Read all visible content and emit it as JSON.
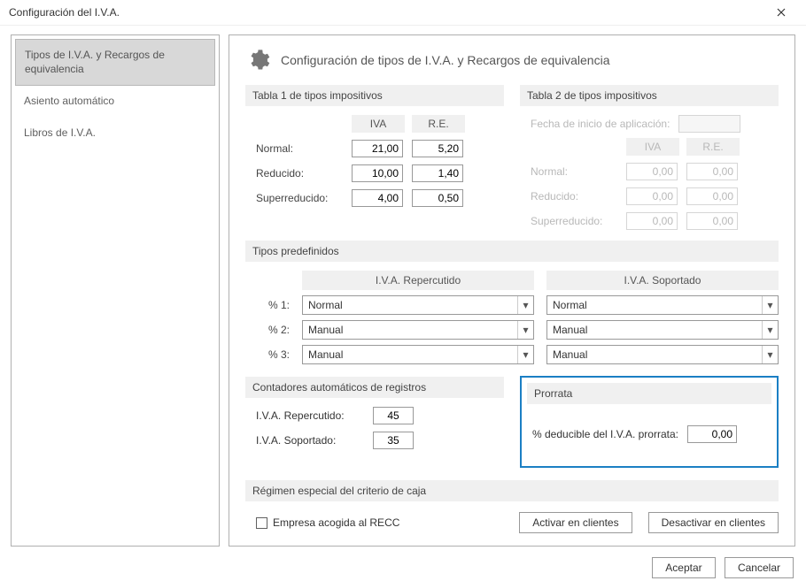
{
  "window": {
    "title": "Configuración del I.V.A."
  },
  "sidebar": {
    "items": [
      {
        "label": "Tipos de I.V.A. y Recargos de equivalencia",
        "active": true
      },
      {
        "label": "Asiento automático",
        "active": false
      },
      {
        "label": "Libros de I.V.A.",
        "active": false
      }
    ]
  },
  "page": {
    "title": "Configuración de tipos de I.V.A. y Recargos de equivalencia"
  },
  "tabla1": {
    "header": "Tabla 1 de tipos impositivos",
    "col_iva": "IVA",
    "col_re": "R.E.",
    "rows": {
      "normal": {
        "label": "Normal:",
        "iva": "21,00",
        "re": "5,20"
      },
      "reducido": {
        "label": "Reducido:",
        "iva": "10,00",
        "re": "1,40"
      },
      "superreducido": {
        "label": "Superreducido:",
        "iva": "4,00",
        "re": "0,50"
      }
    }
  },
  "tabla2": {
    "header": "Tabla 2 de tipos impositivos",
    "fecha_label": "Fecha de inicio de aplicación:",
    "col_iva": "IVA",
    "col_re": "R.E.",
    "rows": {
      "normal": {
        "label": "Normal:",
        "iva": "0,00",
        "re": "0,00"
      },
      "reducido": {
        "label": "Reducido:",
        "iva": "0,00",
        "re": "0,00"
      },
      "superreducido": {
        "label": "Superreducido:",
        "iva": "0,00",
        "re": "0,00"
      }
    }
  },
  "predef": {
    "header": "Tipos predefinidos",
    "group_rep": "I.V.A. Repercutido",
    "group_sop": "I.V.A. Soportado",
    "row1_label": "% 1:",
    "row2_label": "% 2:",
    "row3_label": "% 3:",
    "rep": [
      "Normal",
      "Manual",
      "Manual"
    ],
    "sop": [
      "Normal",
      "Manual",
      "Manual"
    ]
  },
  "contadores": {
    "header": "Contadores automáticos de registros",
    "rep_label": "I.V.A. Repercutido:",
    "rep_value": "45",
    "sop_label": "I.V.A. Soportado:",
    "sop_value": "35"
  },
  "prorrata": {
    "header": "Prorrata",
    "label": "% deducible del I.V.A. prorrata:",
    "value": "0,00"
  },
  "recc": {
    "header": "Régimen especial del criterio de caja",
    "checkbox_label": "Empresa acogida al RECC",
    "btn_activar": "Activar en clientes",
    "btn_desactivar": "Desactivar en clientes"
  },
  "footer": {
    "btn_ok": "Aceptar",
    "btn_cancel": "Cancelar"
  }
}
